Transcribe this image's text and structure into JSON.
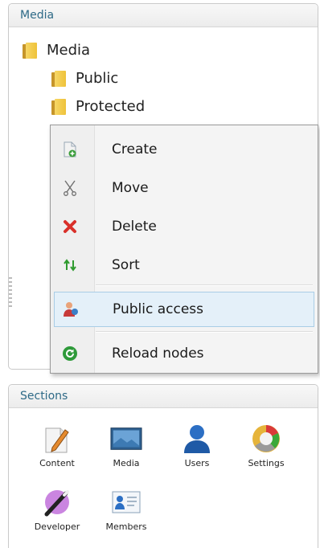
{
  "media_panel": {
    "title": "Media",
    "tree": [
      {
        "label": "Media"
      },
      {
        "label": "Public"
      },
      {
        "label": "Protected"
      }
    ]
  },
  "context_menu": {
    "items": [
      {
        "label": "Create",
        "icon": "create-icon"
      },
      {
        "label": "Move",
        "icon": "scissors-icon"
      },
      {
        "label": "Delete",
        "icon": "delete-icon"
      },
      {
        "label": "Sort",
        "icon": "sort-icon"
      },
      {
        "label": "Public access",
        "icon": "public-access-icon"
      },
      {
        "label": "Reload nodes",
        "icon": "reload-icon"
      }
    ]
  },
  "sections_panel": {
    "title": "Sections",
    "items": [
      {
        "label": "Content",
        "icon": "content-icon"
      },
      {
        "label": "Media",
        "icon": "media-icon"
      },
      {
        "label": "Users",
        "icon": "users-icon"
      },
      {
        "label": "Settings",
        "icon": "settings-icon"
      },
      {
        "label": "Developer",
        "icon": "developer-icon"
      },
      {
        "label": "Members",
        "icon": "members-icon"
      }
    ]
  },
  "colors": {
    "panel_title": "#2e6a87",
    "menu_highlight": "#e4f0f9",
    "folder": "#eec23a"
  }
}
